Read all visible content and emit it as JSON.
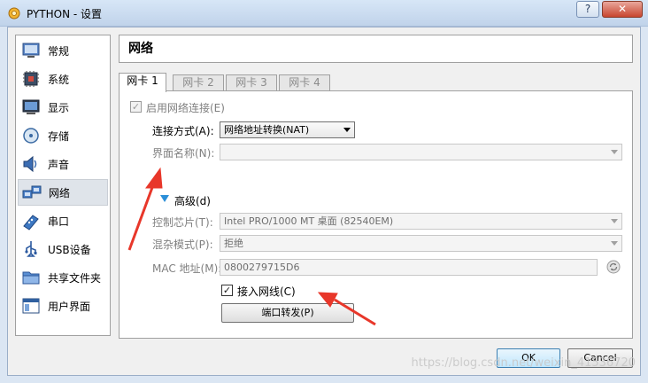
{
  "window": {
    "title": "PYTHON - 设置",
    "help_label": "?",
    "close_label": "✕"
  },
  "nav": {
    "items": [
      {
        "label": "常规",
        "icon": "monitor-icon"
      },
      {
        "label": "系统",
        "icon": "chip-icon"
      },
      {
        "label": "显示",
        "icon": "display-icon"
      },
      {
        "label": "存储",
        "icon": "disk-icon"
      },
      {
        "label": "声音",
        "icon": "speaker-icon"
      },
      {
        "label": "网络",
        "icon": "network-icon",
        "selected": true
      },
      {
        "label": "串口",
        "icon": "serial-port-icon"
      },
      {
        "label": "USB设备",
        "icon": "usb-icon"
      },
      {
        "label": "共享文件夹",
        "icon": "folder-icon"
      },
      {
        "label": "用户界面",
        "icon": "window-icon"
      }
    ]
  },
  "page": {
    "title": "网络",
    "tabs": [
      {
        "label": "网卡 1",
        "active": true
      },
      {
        "label": "网卡 2"
      },
      {
        "label": "网卡 3"
      },
      {
        "label": "网卡 4"
      }
    ]
  },
  "adapter": {
    "enable_label": "启用网络连接(E)",
    "attach_label": "连接方式(A):",
    "attach_value": "网络地址转换(NAT)",
    "name_label": "界面名称(N):",
    "name_value": "",
    "advanced_label": "高级(d)",
    "chip_label": "控制芯片(T):",
    "chip_value": "Intel PRO/1000 MT 桌面 (82540EM)",
    "promisc_label": "混杂模式(P):",
    "promisc_value": "拒绝",
    "mac_label": "MAC 地址(M):",
    "mac_value": "0800279715D6",
    "cable_label": "接入网线(C)",
    "port_forward_label": "端口转发(P)"
  },
  "footer": {
    "ok_label": "OK",
    "cancel_label": "Cancel",
    "watermark": "https://blog.csdn.net/weixin_41536720"
  },
  "colors": {
    "annotation_arrow": "#e8372a",
    "selection": "#dfe4ea"
  }
}
